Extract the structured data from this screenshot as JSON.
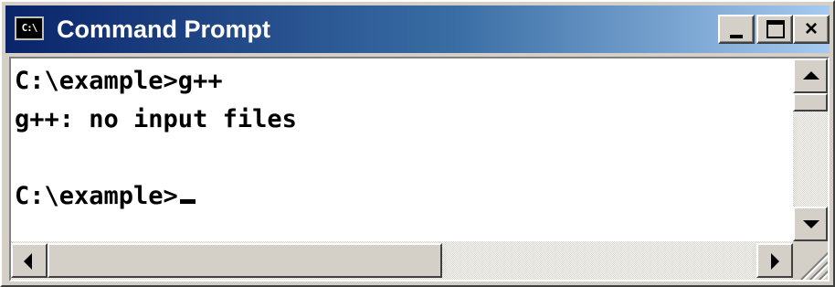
{
  "window": {
    "title": "Command Prompt",
    "icon": "console-icon",
    "icon_text": "C:\\"
  },
  "caption_buttons": {
    "minimize": "minimize-icon",
    "maximize": "maximize-icon",
    "close": "close-icon",
    "close_glyph": "×"
  },
  "console": {
    "lines": [
      "C:\\example>g++",
      "g++: no input files",
      "",
      "C:\\example>"
    ]
  },
  "scrollbars": {
    "vertical": {
      "up": "arrow-up-icon",
      "down": "arrow-down-icon"
    },
    "horizontal": {
      "left": "arrow-left-icon",
      "right": "arrow-right-icon"
    }
  },
  "colors": {
    "titlebar_start": "#0a246a",
    "titlebar_end": "#a6caf0",
    "console_bg": "#ffffff",
    "console_fg": "#000000",
    "chrome": "#d4d0c8"
  }
}
